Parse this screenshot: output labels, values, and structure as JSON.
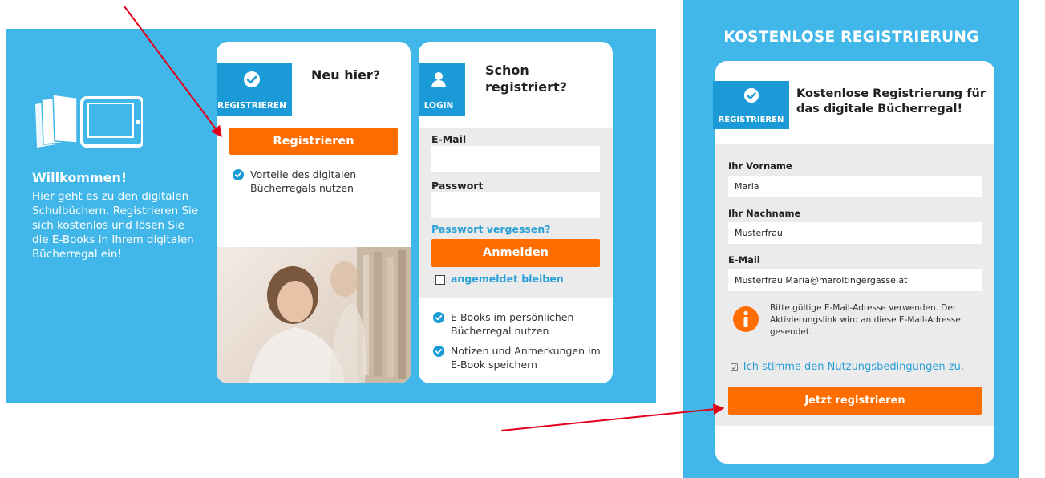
{
  "welcome": {
    "title": "Willkommen!",
    "text": "Hier geht es zu den digitalen Schulbüchern. Registrieren Sie sich kostenlos und lösen Sie die E-Books in Ihrem digitalen Bücherregal ein!"
  },
  "register_card": {
    "badge_label": "REGISTRIEREN",
    "title": "Neu hier?",
    "button_label": "Registrieren",
    "feature": "Vorteile des digitalen Bücherregals nutzen"
  },
  "login_card": {
    "badge_label": "LOGIN",
    "title": "Schon registriert?",
    "email_label": "E-Mail",
    "email_value": "",
    "password_label": "Passwort",
    "password_value": "",
    "forgot_link": "Passwort vergessen?",
    "login_button": "Anmelden",
    "remember_label": "angemeldet bleiben",
    "features": [
      "E-Books im persönlichen Bücherregal nutzen",
      "Notizen und Anmerkungen im E-Book speichern"
    ]
  },
  "registration_form": {
    "panel_title": "KOSTENLOSE REGISTRIERUNG",
    "badge_label": "REGISTRIEREN",
    "heading": "Kostenlose Registrierung für das digitale Bücherregal!",
    "firstname_label": "Ihr Vorname",
    "firstname_value": "Maria",
    "lastname_label": "Ihr Nachname",
    "lastname_value": "Musterfrau",
    "email_label": "E-Mail",
    "email_value": "Musterfrau.Maria@maroltingergasse.at",
    "info_text": "Bitte gültige E-Mail-Adresse verwenden. Der Aktivierungslink wird an diese E-Mail-Adresse gesendet.",
    "terms_label": "Ich stimme den Nutzungsbedingungen zu.",
    "terms_checked": true,
    "submit_label": "Jetzt registrieren"
  },
  "colors": {
    "panel_blue": "#41b6e8",
    "badge_blue": "#1a9bd7",
    "accent_orange": "#ff6c00",
    "link_blue": "#2a9fd8",
    "annotation_red": "#e3001b"
  },
  "icons": {
    "badge_register": "check-circle-icon",
    "badge_login": "user-icon",
    "info": "info-icon",
    "welcome": "ebook-tablet-icon"
  }
}
